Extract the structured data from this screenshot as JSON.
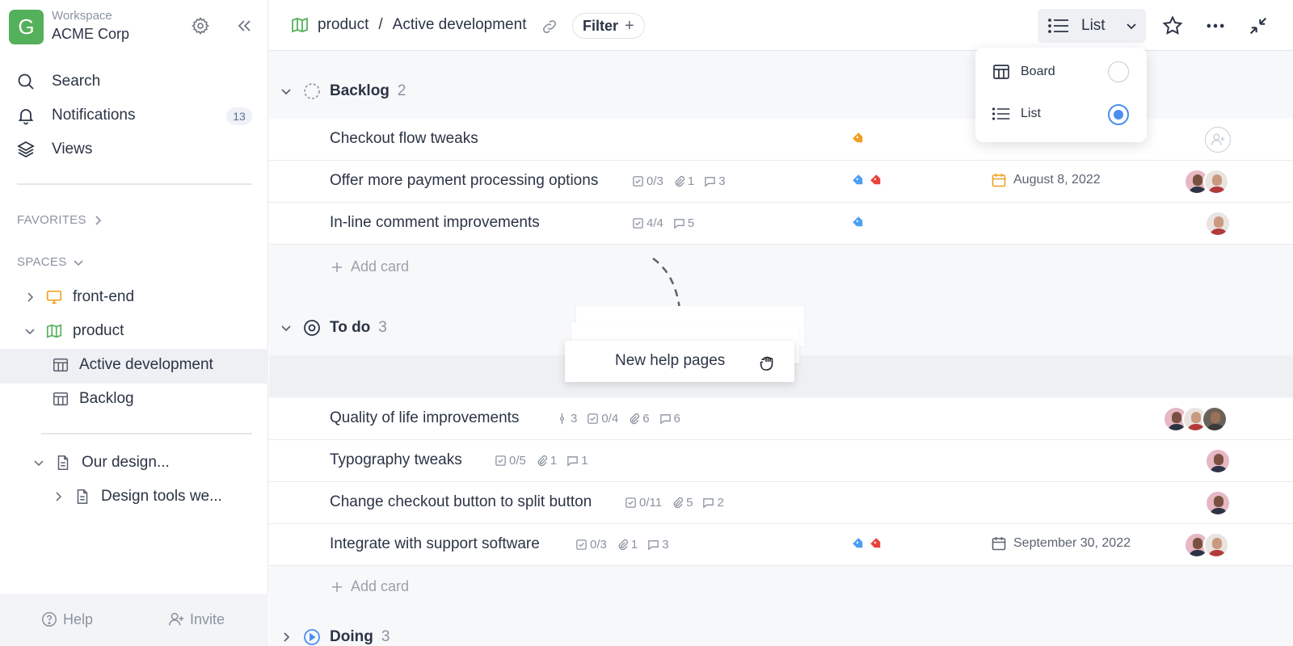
{
  "workspace": {
    "logo_letter": "G",
    "label": "Workspace",
    "name": "ACME Corp"
  },
  "nav": {
    "search": "Search",
    "notifications": "Notifications",
    "notifications_count": "13",
    "views": "Views"
  },
  "sidebar": {
    "favorites": "FAVORITES",
    "spaces": "SPACES",
    "tree": {
      "front_end": "front-end",
      "product": "product",
      "active_development": "Active development",
      "backlog": "Backlog",
      "our_design": "Our design...",
      "design_tools": "Design tools we..."
    },
    "footer": {
      "help": "Help",
      "invite": "Invite"
    }
  },
  "topbar": {
    "space": "product",
    "separator": "/",
    "board": "Active development",
    "filter": "Filter",
    "filter_plus": "+",
    "view": "List"
  },
  "view_menu": {
    "board": "Board",
    "list": "List",
    "selected": "List"
  },
  "groups": {
    "backlog": {
      "title": "Backlog",
      "count": "2"
    },
    "todo": {
      "title": "To do",
      "count": "3"
    },
    "doing": {
      "title": "Doing",
      "count": "3"
    }
  },
  "backlog_cards": [
    {
      "title": "Checkout flow tweaks"
    },
    {
      "title": "Offer more payment processing options",
      "checklist": "0/3",
      "attachments": "1",
      "comments": "3",
      "due": "August 8, 2022"
    },
    {
      "title": "In-line comment improvements",
      "checklist": "4/4",
      "comments": "5"
    }
  ],
  "todo_cards": [
    {
      "title": "Quality of life improvements",
      "subtasks": "3",
      "checklist": "0/4",
      "attachments": "6",
      "comments": "6"
    },
    {
      "title": "Typography tweaks",
      "checklist": "0/5",
      "attachments": "1",
      "comments": "1"
    },
    {
      "title": "Change checkout button to split button",
      "checklist": "0/11",
      "attachments": "5",
      "comments": "2"
    },
    {
      "title": "Integrate with support software",
      "checklist": "0/3",
      "attachments": "1",
      "comments": "3",
      "due": "September 30, 2022"
    }
  ],
  "add_card": "Add card",
  "dragging_card": "New help pages",
  "colors": {
    "accent": "#4a8ef0",
    "workspace_logo": "#54b05a",
    "tag_orange": "#f0a020",
    "tag_blue": "#4a9ff5",
    "tag_red": "#e8433a",
    "due_warning": "#f0a020"
  }
}
